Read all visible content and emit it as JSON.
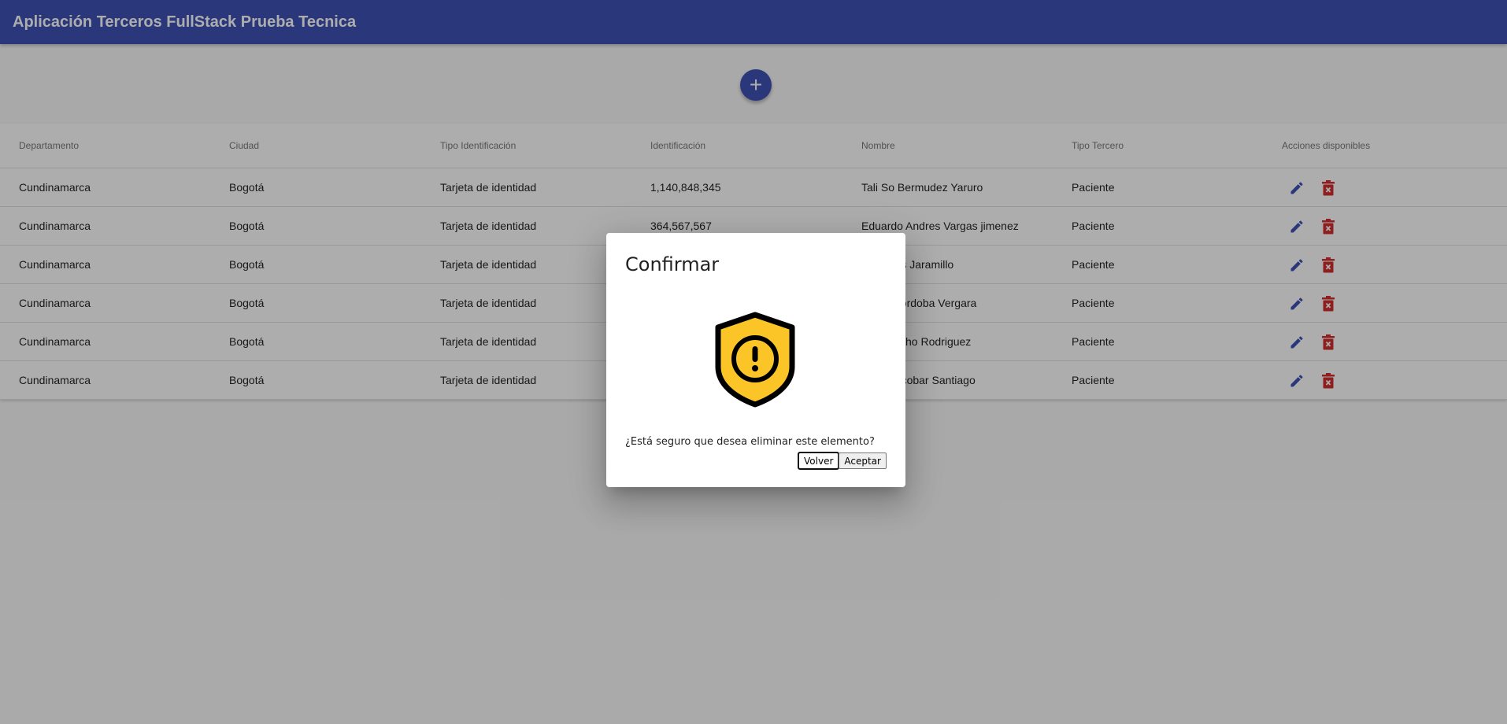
{
  "app": {
    "title": "Aplicación Terceros FullStack Prueba Tecnica"
  },
  "fab": {
    "icon": "plus-icon",
    "label": "+"
  },
  "table": {
    "columns": [
      "Departamento",
      "Ciudad",
      "Tipo Identificación",
      "Identificación",
      "Nombre",
      "Tipo Tercero",
      "Acciones disponibles"
    ],
    "rows": [
      [
        "Cundinamarca",
        "Bogotá",
        "Tarjeta de identidad",
        "1,140,848,345",
        "Tali So Bermudez Yaruro",
        "Paciente"
      ],
      [
        "Cundinamarca",
        "Bogotá",
        "Tarjeta de identidad",
        "364,567,567",
        "Eduardo Andres Vargas jimenez",
        "Paciente"
      ],
      [
        "Cundinamarca",
        "Bogotá",
        "Tarjeta de identidad",
        "",
        "se Torres Jaramillo",
        "Paciente"
      ],
      [
        "Cundinamarca",
        "Bogotá",
        "Tarjeta de identidad",
        "",
        "uardo Cordoba Vergara",
        "Paciente"
      ],
      [
        "Cundinamarca",
        "Bogotá",
        "Tarjeta de identidad",
        "",
        "e Camacho Rodriguez",
        "Paciente"
      ],
      [
        "Cundinamarca",
        "Bogotá",
        "Tarjeta de identidad",
        "",
        "avier Escobar Santiago",
        "Paciente"
      ]
    ],
    "actions": {
      "edit_icon": "pencil-icon",
      "delete_icon": "trash-icon"
    }
  },
  "dialog": {
    "title": "Confirmar",
    "icon": "shield-warning-icon",
    "message": "¿Está seguro que desea eliminar este elemento?",
    "cancel_label": "Volver",
    "accept_label": "Aceptar"
  },
  "colors": {
    "primary": "#3f51b5",
    "danger": "#d32f2f",
    "warning": "#fcc527"
  }
}
